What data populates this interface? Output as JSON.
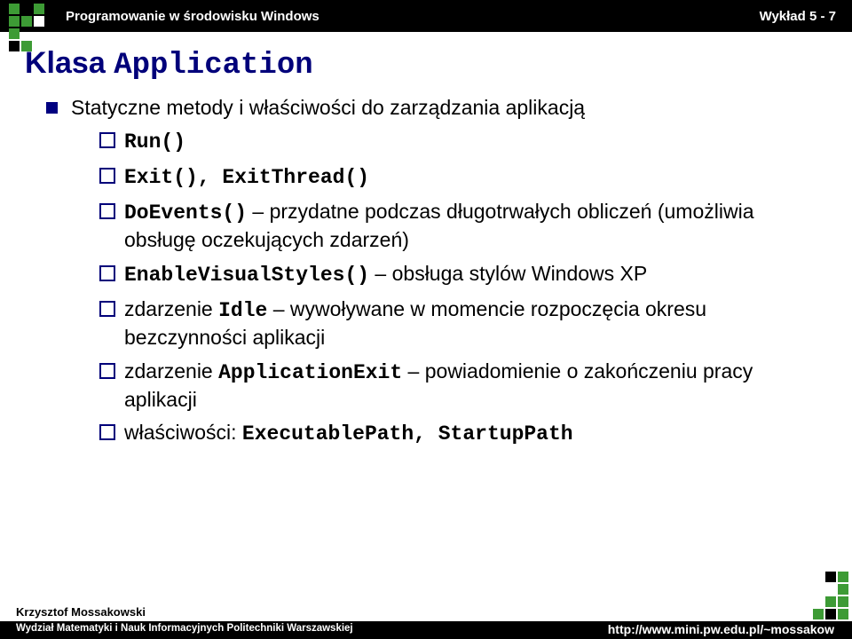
{
  "header": {
    "course": "Programowanie w środowisku Windows",
    "lecture": "Wykład 5 - 7"
  },
  "heading": {
    "text": "Klasa",
    "mono": "Application"
  },
  "bullets": {
    "main": "Statyczne metody i właściwości do zarządzania aplikacją",
    "items": [
      {
        "mono": "Run()",
        "rest": ""
      },
      {
        "mono": "Exit(), ExitThread()",
        "rest": ""
      },
      {
        "mono": "DoEvents()",
        "rest": " – przydatne podczas długotrwałych obliczeń (umożliwia obsługę oczekujących zdarzeń)"
      },
      {
        "mono": "EnableVisualStyles()",
        "rest": " – obsługa stylów Windows XP"
      },
      {
        "pre": "zdarzenie ",
        "mono": "Idle",
        "rest": " – wywoływane w momencie rozpoczęcia okresu bezczynności aplikacji"
      },
      {
        "pre": "zdarzenie ",
        "mono": "ApplicationExit",
        "rest": " – powiadomienie o zakończeniu pracy aplikacji"
      },
      {
        "pre": "właściwości: ",
        "mono": "ExecutablePath, StartupPath",
        "rest": ""
      }
    ]
  },
  "footer": {
    "author": "Krzysztof Mossakowski",
    "dept": "Wydział Matematyki i Nauk Informacyjnych Politechniki Warszawskiej",
    "url": "http://www.mini.pw.edu.pl/~mossakow"
  }
}
